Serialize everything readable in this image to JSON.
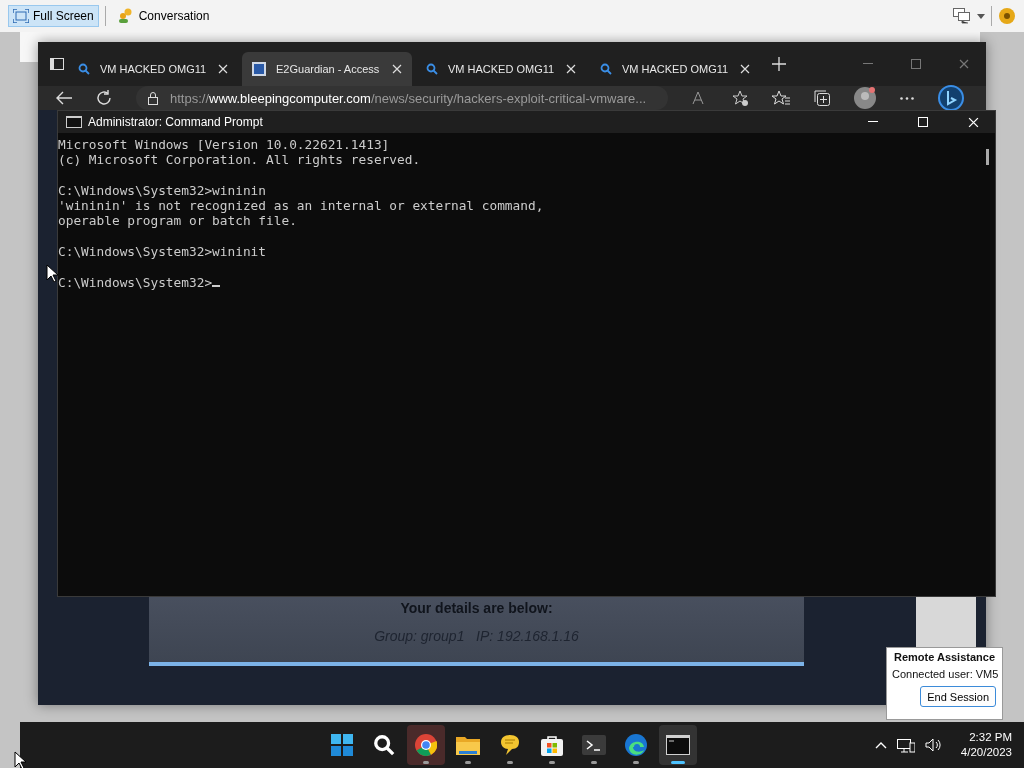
{
  "toolbar": {
    "buttons": [
      {
        "label": "Full Screen",
        "kind": "fullscreen",
        "selected": true
      },
      {
        "label": "Conversation",
        "kind": "chat",
        "selected": false
      }
    ]
  },
  "browser": {
    "tabs": [
      {
        "label": "VM HACKED OMG11",
        "kind": "search",
        "selected": false
      },
      {
        "label": "E2Guardian - Access",
        "kind": "page",
        "selected": true
      },
      {
        "label": "VM HACKED OMG11",
        "kind": "search",
        "selected": false
      },
      {
        "label": "VM HACKED OMG11",
        "kind": "search",
        "selected": false
      }
    ],
    "url": {
      "scheme": "https://",
      "host": "www.bleepingcomputer.com",
      "path": "/news/security/hackers-exploit-critical-vmware..."
    },
    "page": {
      "heading": "Your details are below:",
      "details": "Group: group1   IP: 192.168.1.16"
    }
  },
  "console": {
    "title": "Administrator: Command Prompt",
    "blocks": [
      [
        "Microsoft Windows [Version 10.0.22621.1413]",
        "(c) Microsoft Corporation. All rights reserved."
      ],
      [
        "C:\\Windows\\System32>wininin",
        "'wininin' is not recognized as an internal or external command,",
        "operable program or batch file."
      ],
      [
        "C:\\Windows\\System32>wininit"
      ],
      [
        "C:\\Windows\\System32>"
      ]
    ]
  },
  "assist_popup": {
    "title": "Remote Assistance",
    "status": "Connected user: VM5",
    "button": "End Session"
  },
  "taskbar": {
    "apps": [
      {
        "kind": "start",
        "running": false,
        "flashing": false,
        "selected": false
      },
      {
        "kind": "search",
        "running": false,
        "flashing": false,
        "selected": false
      },
      {
        "kind": "chrome",
        "running": true,
        "flashing": true,
        "selected": false
      },
      {
        "kind": "folder",
        "running": true,
        "flashing": false,
        "selected": false
      },
      {
        "kind": "chat",
        "running": true,
        "flashing": false,
        "selected": false
      },
      {
        "kind": "store",
        "running": true,
        "flashing": false,
        "selected": false
      },
      {
        "kind": "terminal",
        "running": true,
        "flashing": false,
        "selected": false
      },
      {
        "kind": "edge",
        "running": true,
        "flashing": false,
        "selected": false
      },
      {
        "kind": "console",
        "running": true,
        "flashing": false,
        "selected": true
      }
    ],
    "clock": {
      "time": "2:32 PM",
      "date": "4/20/2023"
    }
  }
}
